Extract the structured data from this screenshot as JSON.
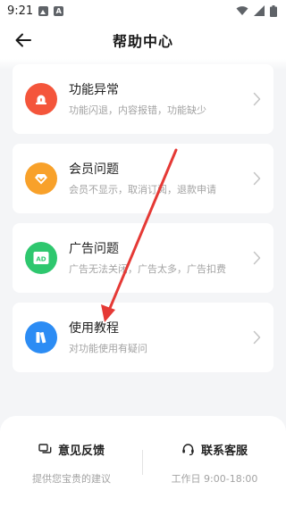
{
  "status_bar": {
    "time": "9:21"
  },
  "header": {
    "title": "帮助中心"
  },
  "cards": [
    {
      "title": "功能异常",
      "subtitle": "功能闪退，内容报错，功能缺少",
      "icon": "alarm-icon",
      "color": "#f4553b"
    },
    {
      "title": "会员问题",
      "subtitle": "会员不显示，取消订阅，退款申请",
      "icon": "diamond-icon",
      "color": "#f8a12a"
    },
    {
      "title": "广告问题",
      "subtitle": "广告无法关闭，广告太多，广告扣费",
      "icon": "ad-icon",
      "color": "#2ec76e"
    },
    {
      "title": "使用教程",
      "subtitle": "对功能使用有疑问",
      "icon": "book-icon",
      "color": "#2c8cf4"
    }
  ],
  "bottom": {
    "feedback": {
      "title": "意见反馈",
      "subtitle": "提供您宝贵的建议",
      "icon": "chat-icon"
    },
    "service": {
      "title": "联系客服",
      "subtitle": "工作日 9:00-18:00",
      "icon": "headset-icon"
    }
  },
  "annotation": {
    "type": "arrow",
    "color": "#e53935"
  }
}
